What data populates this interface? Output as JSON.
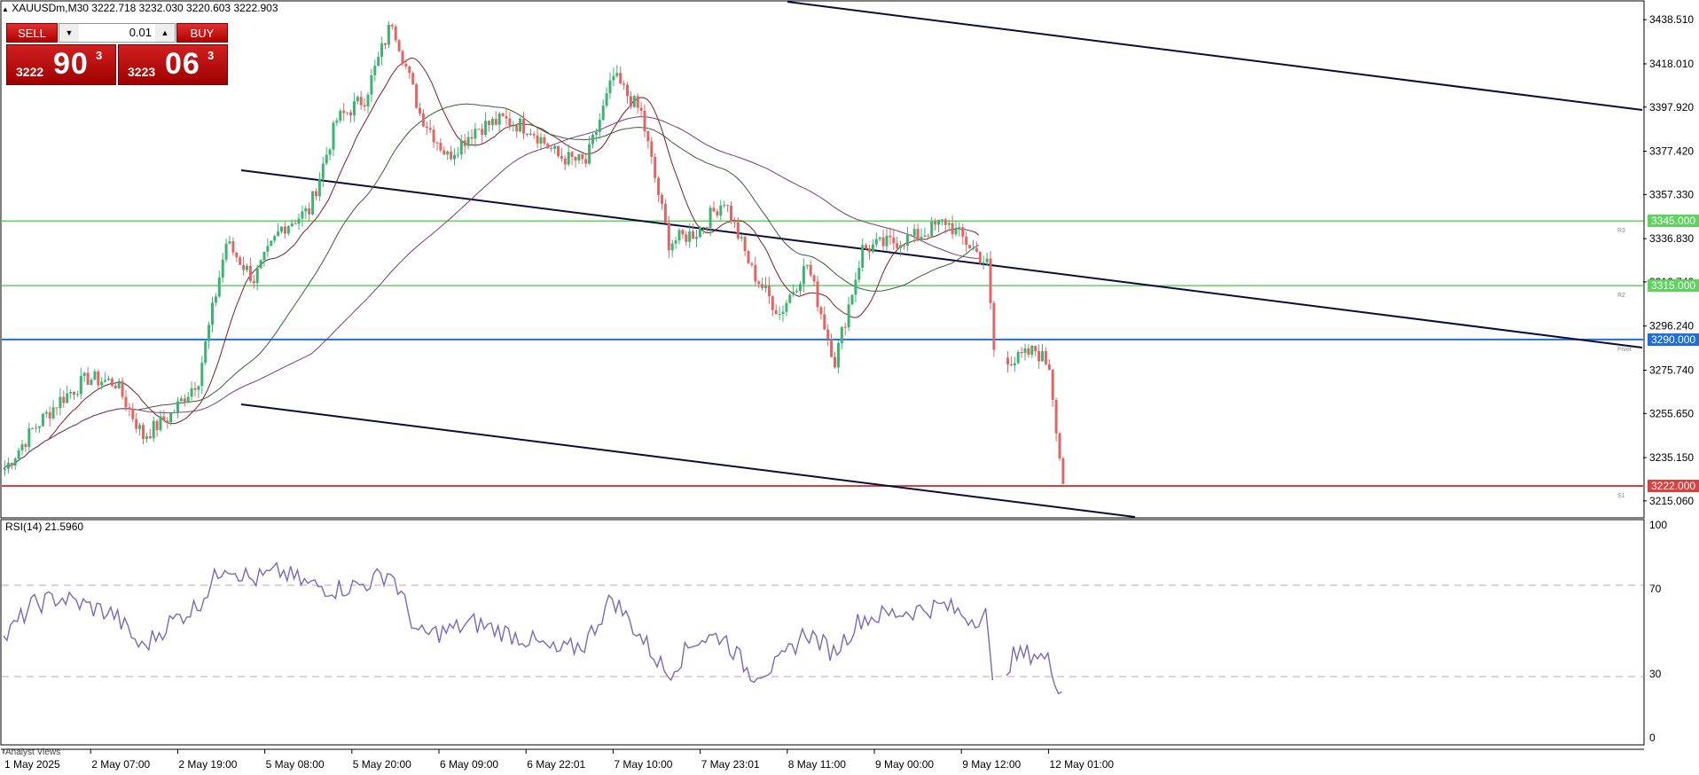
{
  "header": {
    "symbol_line": "XAUUSDm,M30  3222.718 3232.030 3220.603 3222.903"
  },
  "trade_panel": {
    "sell_label": "SELL",
    "buy_label": "BUY",
    "lot_value": "0.01",
    "sell_price_small": "3222",
    "sell_price_big": "90",
    "sell_price_sup": "3",
    "buy_price_small": "3223",
    "buy_price_big": "06",
    "buy_price_sup": "3",
    "down_arrow_icon": "chevron-down-icon",
    "up_arrow_icon": "chevron-up-icon"
  },
  "price_axis": {
    "labels": [
      "3438.510",
      "3418.010",
      "3397.920",
      "3377.420",
      "3357.330",
      "3336.830",
      "3316.740",
      "3296.240",
      "3275.740",
      "3255.650",
      "3235.150",
      "3215.060"
    ]
  },
  "rsi_axis": {
    "labels": [
      "100",
      "70",
      "30",
      "0"
    ]
  },
  "time_axis": {
    "labels": [
      "1 May 2025",
      "2 May 07:00",
      "2 May 19:00",
      "5 May 08:00",
      "5 May 20:00",
      "6 May 09:00",
      "6 May 22:01",
      "7 May 10:00",
      "7 May 23:01",
      "8 May 11:00",
      "9 May 00:00",
      "9 May 12:00",
      "12 May 01:00"
    ]
  },
  "levels": [
    {
      "price": 3345.0,
      "label": "3345.000",
      "tag": "R3",
      "color": "#5fd35f"
    },
    {
      "price": 3315.0,
      "label": "3315.000",
      "tag": "R2",
      "color": "#5fd35f"
    },
    {
      "price": 3290.0,
      "label": "3290.000",
      "tag": "Pivot",
      "color": "#1f6fd6"
    },
    {
      "price": 3222.0,
      "label": "3222.000",
      "tag": "S1",
      "color": "#d94040"
    }
  ],
  "rsi": {
    "title": "RSI(14) 21.5960",
    "levels": [
      70,
      30
    ],
    "color": "#7b68b8"
  },
  "bottom_tab": {
    "label": "Analyst Views"
  },
  "colors": {
    "bull": "#3cb371",
    "bear": "#e06666",
    "trendline": "#0b0b3b"
  },
  "chart_data": {
    "type": "candlestick",
    "symbol": "XAUUSDm",
    "timeframe": "M30",
    "ylim": [
      3208,
      3446
    ],
    "rsi_ylim": [
      0,
      100
    ],
    "close_path": [
      [
        0,
        3230
      ],
      [
        8,
        3248
      ],
      [
        16,
        3262
      ],
      [
        24,
        3272
      ],
      [
        32,
        3270
      ],
      [
        40,
        3245
      ],
      [
        48,
        3255
      ],
      [
        56,
        3272
      ],
      [
        64,
        3335
      ],
      [
        72,
        3318
      ],
      [
        80,
        3342
      ],
      [
        88,
        3350
      ],
      [
        96,
        3392
      ],
      [
        104,
        3402
      ],
      [
        112,
        3438
      ],
      [
        120,
        3395
      ],
      [
        128,
        3375
      ],
      [
        136,
        3388
      ],
      [
        144,
        3392
      ],
      [
        152,
        3388
      ],
      [
        160,
        3375
      ],
      [
        168,
        3372
      ],
      [
        176,
        3412
      ],
      [
        184,
        3395
      ],
      [
        192,
        3335
      ],
      [
        200,
        3340
      ],
      [
        208,
        3355
      ],
      [
        216,
        3322
      ],
      [
        224,
        3302
      ],
      [
        232,
        3325
      ],
      [
        240,
        3280
      ],
      [
        248,
        3332
      ],
      [
        256,
        3335
      ],
      [
        264,
        3338
      ],
      [
        272,
        3345
      ],
      [
        280,
        3332
      ],
      [
        284,
        3325
      ],
      [
        286,
        3285
      ],
      [
        292,
        3280
      ],
      [
        298,
        3285
      ],
      [
        302,
        3278
      ],
      [
        306,
        3222
      ]
    ],
    "rsi_path": [
      [
        0,
        46
      ],
      [
        8,
        62
      ],
      [
        16,
        66
      ],
      [
        24,
        62
      ],
      [
        32,
        58
      ],
      [
        40,
        42
      ],
      [
        48,
        54
      ],
      [
        56,
        62
      ],
      [
        64,
        82
      ],
      [
        72,
        74
      ],
      [
        80,
        78
      ],
      [
        88,
        72
      ],
      [
        96,
        70
      ],
      [
        104,
        72
      ],
      [
        112,
        78
      ],
      [
        120,
        48
      ],
      [
        128,
        50
      ],
      [
        136,
        54
      ],
      [
        144,
        50
      ],
      [
        152,
        46
      ],
      [
        160,
        40
      ],
      [
        168,
        44
      ],
      [
        176,
        66
      ],
      [
        184,
        48
      ],
      [
        192,
        30
      ],
      [
        200,
        46
      ],
      [
        208,
        48
      ],
      [
        216,
        30
      ],
      [
        224,
        34
      ],
      [
        232,
        50
      ],
      [
        240,
        40
      ],
      [
        248,
        56
      ],
      [
        256,
        58
      ],
      [
        264,
        60
      ],
      [
        272,
        62
      ],
      [
        280,
        56
      ],
      [
        284,
        58
      ],
      [
        286,
        24
      ],
      [
        292,
        38
      ],
      [
        298,
        40
      ],
      [
        302,
        36
      ],
      [
        306,
        21.6
      ]
    ]
  }
}
